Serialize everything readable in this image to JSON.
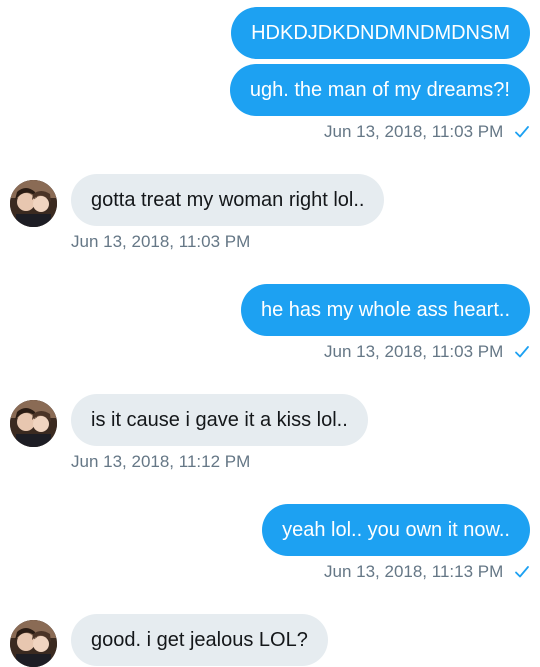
{
  "messages": [
    {
      "text": "HDKDJDKDNDMNDMDNSM"
    },
    {
      "text": "ugh. the man of my dreams?!",
      "timestamp": "Jun 13, 2018, 11:03 PM"
    },
    {
      "text": "gotta treat my woman right lol..",
      "timestamp": "Jun 13, 2018, 11:03 PM"
    },
    {
      "text": "he has my whole ass heart..",
      "timestamp": "Jun 13, 2018, 11:03 PM"
    },
    {
      "text": "is it cause i gave it a kiss lol..",
      "timestamp": "Jun 13, 2018, 11:12 PM"
    },
    {
      "text": "yeah lol.. you own it now..",
      "timestamp": "Jun 13, 2018, 11:13 PM"
    },
    {
      "text": "good. i get jealous LOL?"
    }
  ],
  "colors": {
    "sent_bubble": "#1da1f2",
    "received_bubble": "#e6ecf0",
    "timestamp": "#657786",
    "read_check": "#1da1f2"
  },
  "icons": {
    "read_receipt": "checkmark-icon",
    "contact_avatar": "avatar"
  }
}
